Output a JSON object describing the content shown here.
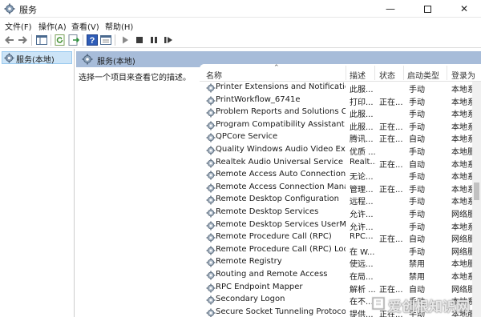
{
  "window": {
    "title": "服务"
  },
  "menu": [
    "文件(F)",
    "操作(A)",
    "查看(V)",
    "帮助(H)"
  ],
  "toolbar": {
    "icons": [
      "back-icon",
      "forward-icon",
      "show-tree-icon",
      "refresh-icon",
      "export-icon",
      "help-icon",
      "properties-icon",
      "play-icon",
      "stop-icon",
      "pause-icon",
      "restart-icon"
    ]
  },
  "tree": {
    "item": "服务(本地)"
  },
  "panel": {
    "title": "服务(本地)",
    "description": "选择一个项目来查看它的描述。"
  },
  "columns": {
    "name": "名称",
    "desc": "描述",
    "status": "状态",
    "startup": "启动类型",
    "logon": "登录为"
  },
  "services": [
    {
      "name": "Printer Extensions and Notifications",
      "desc": "此服...",
      "status": "",
      "startup": "手动",
      "logon": "本地系"
    },
    {
      "name": "PrintWorkflow_6741e",
      "desc": "打印...",
      "status": "正在...",
      "startup": "手动",
      "logon": "本地系"
    },
    {
      "name": "Problem Reports and Solutions Co...",
      "desc": "此服...",
      "status": "",
      "startup": "手动",
      "logon": "本地系"
    },
    {
      "name": "Program Compatibility Assistant Se...",
      "desc": "此服...",
      "status": "正在...",
      "startup": "手动",
      "logon": "本地系"
    },
    {
      "name": "QPCore Service",
      "desc": "腾讯...",
      "status": "正在...",
      "startup": "自动",
      "logon": "本地系"
    },
    {
      "name": "Quality Windows Audio Video Expe...",
      "desc": "优质 ...",
      "status": "",
      "startup": "手动",
      "logon": "本地服"
    },
    {
      "name": "Realtek Audio Universal Service",
      "desc": "Realt...",
      "status": "正在...",
      "startup": "自动",
      "logon": "本地系"
    },
    {
      "name": "Remote Access Auto Connection M...",
      "desc": "无论...",
      "status": "",
      "startup": "手动",
      "logon": "本地系"
    },
    {
      "name": "Remote Access Connection Manager",
      "desc": "管理...",
      "status": "正在...",
      "startup": "手动",
      "logon": "本地系"
    },
    {
      "name": "Remote Desktop Configuration",
      "desc": "远程...",
      "status": "",
      "startup": "手动",
      "logon": "本地系"
    },
    {
      "name": "Remote Desktop Services",
      "desc": "允许...",
      "status": "",
      "startup": "手动",
      "logon": "网络服"
    },
    {
      "name": "Remote Desktop Services UserMo...",
      "desc": "允许...",
      "status": "",
      "startup": "手动",
      "logon": "本地系"
    },
    {
      "name": "Remote Procedure Call (RPC)",
      "desc": "RPC...",
      "status": "正在...",
      "startup": "自动",
      "logon": "网络服"
    },
    {
      "name": "Remote Procedure Call (RPC) Locat...",
      "desc": "在 W...",
      "status": "",
      "startup": "手动",
      "logon": "网络服"
    },
    {
      "name": "Remote Registry",
      "desc": "使远...",
      "status": "",
      "startup": "禁用",
      "logon": "本地服"
    },
    {
      "name": "Routing and Remote Access",
      "desc": "在局...",
      "status": "",
      "startup": "禁用",
      "logon": "本地系"
    },
    {
      "name": "RPC Endpoint Mapper",
      "desc": "解析 ...",
      "status": "正在...",
      "startup": "自动",
      "logon": "网络服"
    },
    {
      "name": "Secondary Logon",
      "desc": "在不...",
      "status": "",
      "startup": "手动",
      "logon": "本地系"
    },
    {
      "name": "Secure Socket Tunneling Protocol S...",
      "desc": "提供...",
      "status": "正在...",
      "startup": "手动",
      "logon": "本地服"
    }
  ],
  "watermark": {
    "text": "爱创根知识网"
  }
}
